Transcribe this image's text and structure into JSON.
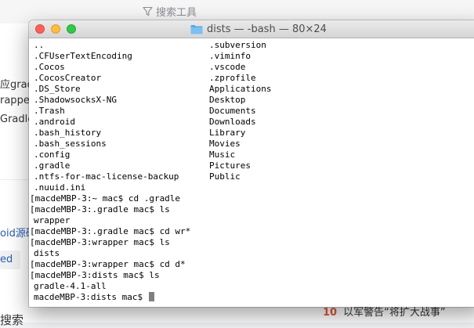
{
  "background": {
    "search_label": "搜索工具",
    "left_fragments": [
      "应gradle",
      "rapper/",
      "Gradle",
      "oid源码",
      "ed"
    ],
    "bottom_news_number": "10",
    "bottom_news_text": "以军警告“将扩大战事”",
    "bottom_left_text": "搜索"
  },
  "terminal": {
    "title": "dists — -bash — 80×24",
    "listing_left": [
      "..",
      ".CFUserTextEncoding",
      ".Cocos",
      ".CocosCreator",
      ".DS_Store",
      ".ShadowsocksX-NG",
      ".Trash",
      ".android",
      ".bash_history",
      ".bash_sessions",
      ".config",
      ".gradle",
      ".ntfs-for-mac-license-backup",
      ".nuuid.ini"
    ],
    "listing_right": [
      ".subversion",
      ".viminfo",
      ".vscode",
      ".zprofile",
      "Applications",
      "Desktop",
      "Documents",
      "Downloads",
      "Library",
      "Movies",
      "Music",
      "Pictures",
      "Public"
    ],
    "session": [
      "[macdeMBP-3:~ mac$ cd .gradle",
      "[macdeMBP-3:.gradle mac$ ls",
      "wrapper",
      "[macdeMBP-3:.gradle mac$ cd wr*",
      "[macdeMBP-3:wrapper mac$ ls",
      "dists",
      "[macdeMBP-3:wrapper mac$ cd d*",
      "[macdeMBP-3:dists mac$ ls",
      "gradle-4.1-all"
    ],
    "prompt": "macdeMBP-3:dists mac$ "
  },
  "colors": {
    "close": "#fc605c",
    "minimize": "#fdbc40",
    "maximize": "#34c84a",
    "folder": "#5aa9e6",
    "link": "#2a5db0"
  },
  "icons": [
    "filter-icon",
    "folder-icon",
    "close-icon",
    "minimize-icon",
    "maximize-icon",
    "cursor-icon"
  ]
}
